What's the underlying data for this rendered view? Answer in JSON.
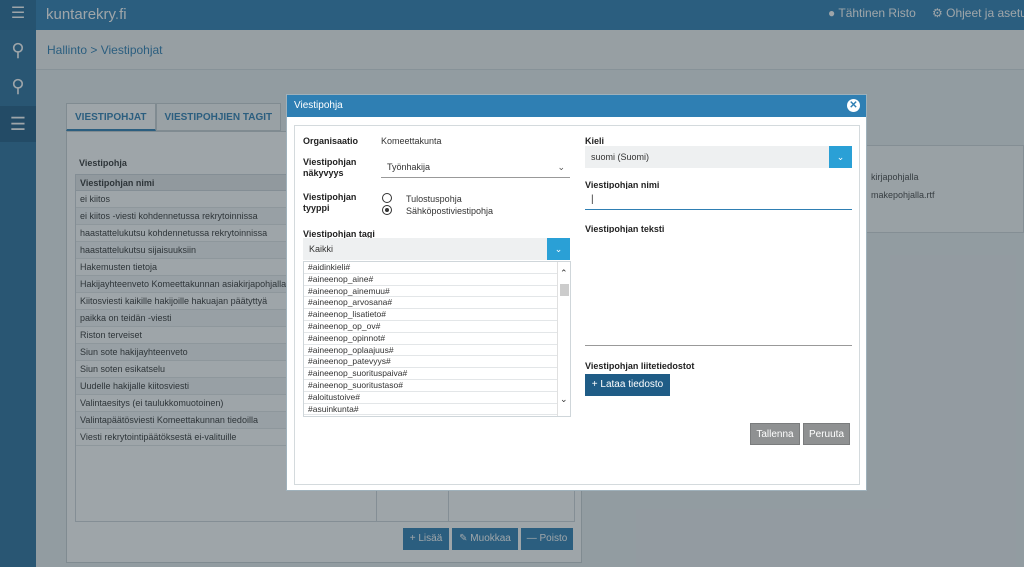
{
  "app": {
    "logo": "kuntarekry",
    "logo_suffix": "fi",
    "user": "Tähtinen Risto",
    "help": "Ohjeet ja asetuks"
  },
  "breadcrumb": "Hallinto > Viestipohjat",
  "tabs": [
    "VIESTIPOHJAT",
    "VIESTIPOHJIEN TAGIT"
  ],
  "list": {
    "title": "Viestipohja",
    "header": "Viestipohjan nimi",
    "rows": [
      "ei kiitos",
      "ei kiitos -viesti kohdennetussa rekrytoinnissa",
      "haastattelukutsu kohdennetussa rekrytoinnissa",
      "haastattelukutsu sijaisuuksiin",
      "Hakemusten tietoja",
      "Hakijayhteenveto Komeettakunnan asiakirjapohjalla",
      "Kiitosviesti kaikille hakijoille hakuajan päätyttyä",
      "paikka on teidän -viesti",
      "Riston terveiset",
      "Siun sote hakijayhteenveto",
      "Siun soten esikatselu",
      "Uudelle hakijalle kiitosviesti",
      "Valintaesitys (ei taulukkomuotoinen)",
      "Valintapäätösviesti Komeettakunnan tiedoilla",
      "Viesti rekrytointipäätöksestä ei-valituille"
    ]
  },
  "buttons": {
    "add": "Lisää",
    "edit": "Muokkaa",
    "delete": "Poisto"
  },
  "side_files": [
    "kirjapohjalla",
    "makepohjalla.rtf"
  ],
  "modal": {
    "title": "Viestipohja",
    "org_label": "Organisaatio",
    "org_value": "Komeettakunta",
    "visibility_label": "Viestipohjan näkyvyys",
    "visibility_value": "Työnhakija",
    "type_label": "Viestipohjan tyyppi",
    "type_options": [
      "Tulostuspohja",
      "Sähköpostiviestipohja"
    ],
    "type_selected": "Sähköpostiviestipohja",
    "tag_label": "Viestipohjan tagi",
    "tag_value": "Kaikki",
    "tags": [
      "#aidinkieli#",
      "#aineenop_aine#",
      "#aineenop_ainemuu#",
      "#aineenop_arvosana#",
      "#aineenop_lisatieto#",
      "#aineenop_op_ov#",
      "#aineenop_opinnot#",
      "#aineenop_oplaajuus#",
      "#aineenop_patevyys#",
      "#aineenop_suorituspaiva#",
      "#aineenop_suoritustaso#",
      "#aloitustoive#",
      "#asuinkunta#"
    ],
    "lang_label": "Kieli",
    "lang_value": "suomi (Suomi)",
    "name_label": "Viestipohjan nimi",
    "name_value": "",
    "text_label": "Viestipohjan teksti",
    "attach_label": "Viestipohjan liitetiedostot",
    "upload_label": "Lataa tiedosto",
    "save_label": "Tallenna",
    "cancel_label": "Peruuta"
  }
}
